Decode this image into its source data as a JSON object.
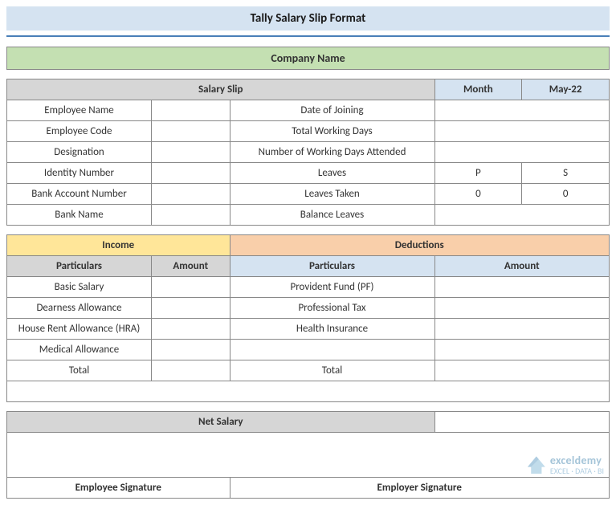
{
  "title": "Tally Salary Slip Format",
  "company_name": "Company Name",
  "salary_slip_header": "Salary Slip",
  "month_label": "Month",
  "month_value": "May-22",
  "left_fields": [
    "Employee Name",
    "Employee Code",
    "Designation",
    "Identity Number",
    "Bank Account Number",
    "Bank Name"
  ],
  "right_fields": [
    "Date of Joining",
    "Total Working Days",
    "Number of Working Days Attended",
    "Leaves",
    "Leaves Taken",
    "Balance Leaves"
  ],
  "leaves_cols": [
    "P",
    "S"
  ],
  "leaves_taken": [
    "0",
    "0"
  ],
  "income_header": "Income",
  "deductions_header": "Deductions",
  "col_particulars": "Particulars",
  "col_amount": "Amount",
  "income_items": [
    "Basic Salary",
    "Dearness Allowance",
    "House Rent Allowance (HRA)",
    "Medical Allowance"
  ],
  "deduction_items": [
    "Provident Fund (PF)",
    "Professional Tax",
    "Health Insurance"
  ],
  "total_label": "Total",
  "net_salary_label": "Net Salary",
  "emp_sig": "Employee Signature",
  "empr_sig": "Employer Signature",
  "watermark": {
    "brand": "exceldemy",
    "tag": "EXCEL · DATA · BI"
  }
}
